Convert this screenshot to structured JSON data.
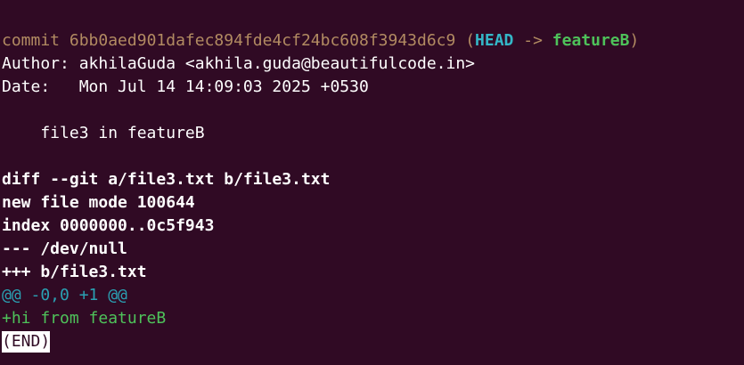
{
  "commit": {
    "label": "commit",
    "hash": "6bb0aed901dafec894fde4cf24bc608f3943d6c9",
    "ref_open": "(",
    "head": "HEAD",
    "arrow": " -> ",
    "branch": "featureB",
    "ref_close": ")"
  },
  "author_line": "Author: akhilaGuda <akhila.guda@beautifulcode.in>",
  "date_line": "Date:   Mon Jul 14 14:09:03 2025 +0530",
  "message": "    file3 in featureB",
  "diff": {
    "header": "diff --git a/file3.txt b/file3.txt",
    "mode": "new file mode 100644",
    "index": "index 0000000..0c5f943",
    "minus_file": "--- /dev/null",
    "plus_file": "+++ b/file3.txt",
    "hunk": "@@ -0,0 +1 @@",
    "added_line": "+hi from featureB"
  },
  "pager_end": "(END)",
  "colors": {
    "background": "#300a24",
    "foreground": "#ffffff",
    "commit": "#b28b62",
    "head": "#34b7c7",
    "branch": "#4ec25a",
    "hunk": "#2aa1b3",
    "added": "#4ec25a"
  }
}
